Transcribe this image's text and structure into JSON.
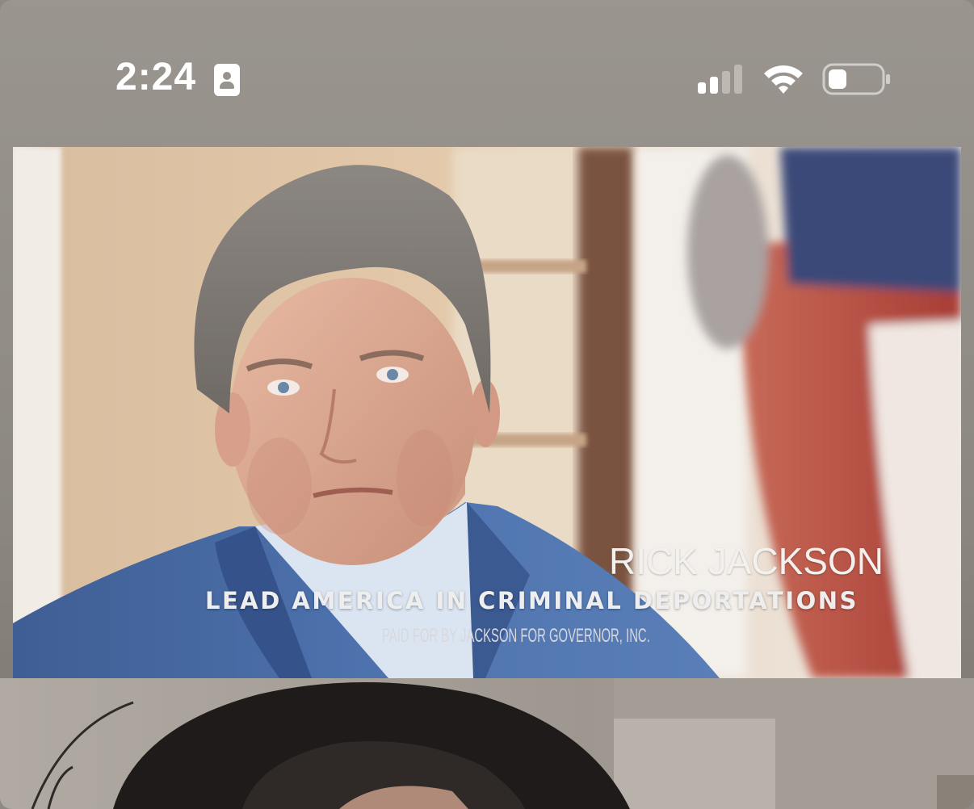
{
  "status_bar": {
    "time": "2:24",
    "icons": {
      "focus": "id-card-icon",
      "signal": "cellular-signal-icon",
      "wifi": "wifi-icon",
      "battery": "battery-icon"
    },
    "signal_bars_active": 2,
    "signal_bars_total": 4,
    "battery_level": 0.2
  },
  "video": {
    "candidate_name": "RICK JACKSON",
    "slogan": "LEAD AMERICA IN CRIMINAL DEPORTATIONS",
    "disclaimer": "PAID FOR BY JACKSON FOR GOVERNOR, INC."
  },
  "colors": {
    "background": "#8e8983",
    "status_text": "#ffffff",
    "suit": "#4a6fa8",
    "shirt": "#d7e2f0",
    "flag_red": "#b8453a",
    "flag_blue": "#3a4a78"
  }
}
